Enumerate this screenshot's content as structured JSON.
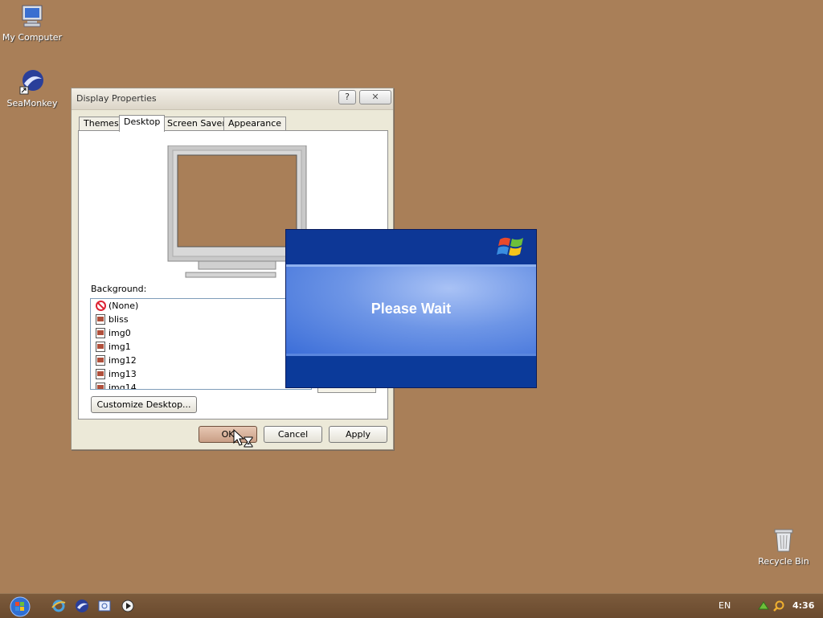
{
  "desktop": {
    "icons": [
      {
        "label": "My Computer"
      },
      {
        "label": "SeaMonkey"
      },
      {
        "label": "Recycle Bin"
      }
    ]
  },
  "window": {
    "title": "Display Properties",
    "help_glyph": "?",
    "close_glyph": "✕",
    "tabs": [
      "Themes",
      "Desktop",
      "Screen Saver",
      "Appearance"
    ],
    "active_tab": "Desktop",
    "background_label": "Background:",
    "background_items": [
      "(None)",
      "bliss",
      "img0",
      "img1",
      "img12",
      "img13",
      "img14"
    ],
    "customize_label": "Customize Desktop...",
    "ok_label": "OK",
    "cancel_label": "Cancel",
    "apply_label": "Apply"
  },
  "splash": {
    "message": "Please Wait"
  },
  "taskbar": {
    "lang": "EN",
    "clock": "4:36"
  },
  "colors": {
    "desktop_bg": "#a97f58",
    "splash_blue": "#0b3a9a"
  }
}
